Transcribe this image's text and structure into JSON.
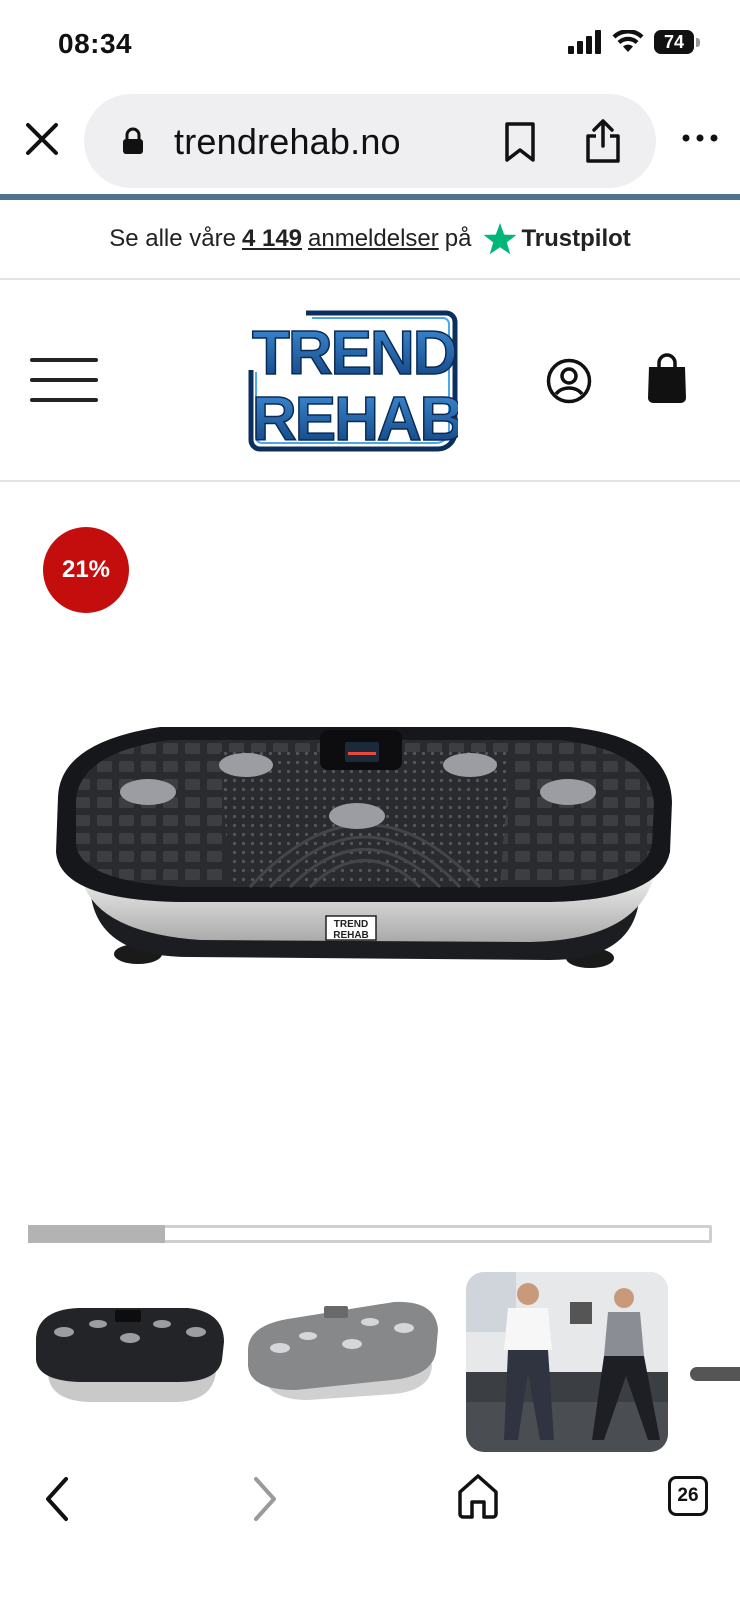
{
  "status": {
    "time": "08:34",
    "battery": "74"
  },
  "browser": {
    "url": "trendrehab.no",
    "tab_count": "26"
  },
  "trust": {
    "prefix": "Se alle våre",
    "count": "4 149",
    "link": "anmeldelser",
    "suffix": "på",
    "brand": "Trustpilot"
  },
  "logo": {
    "line1": "TREND",
    "line2": "REHAB"
  },
  "product": {
    "discount": "21%",
    "plate_brand_1": "TREND",
    "plate_brand_2": "REHAB",
    "gallery_position": 0.2
  },
  "colors": {
    "accent_blue": "#4d7391",
    "discount_red": "#c40d0d",
    "trustpilot_green": "#00b67a",
    "logo_blue": "#1f5fa8"
  }
}
